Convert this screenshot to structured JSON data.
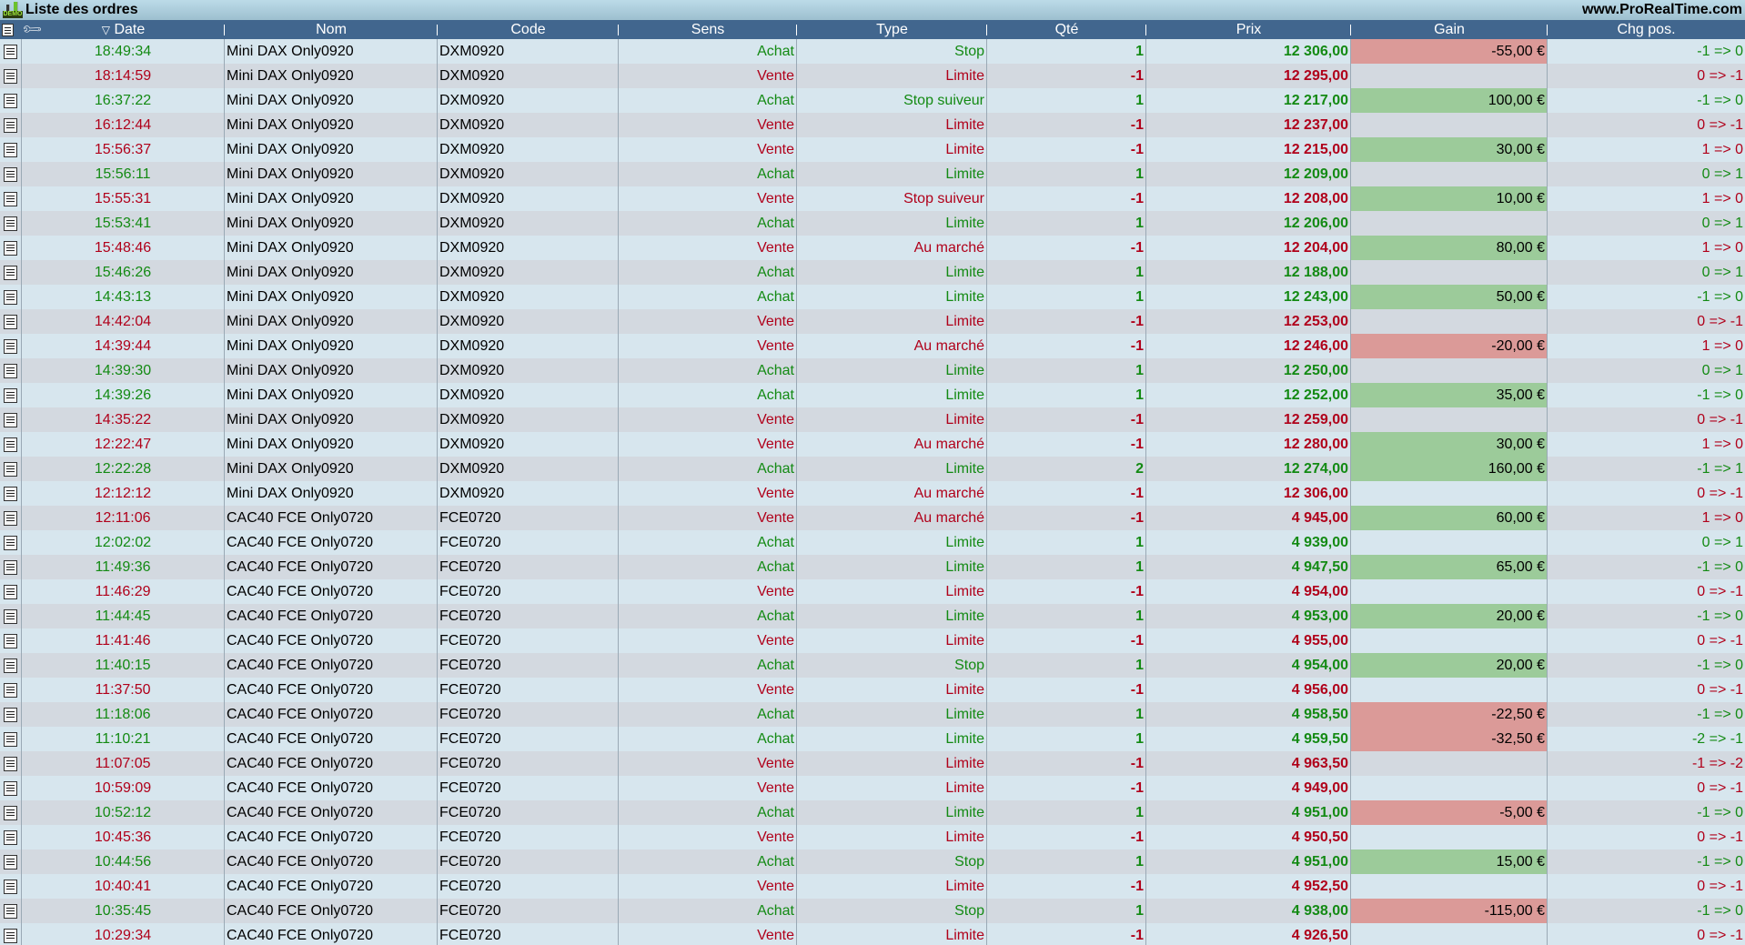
{
  "window": {
    "title": "Liste des ordres",
    "site": "www.ProRealTime.com",
    "badge": "DEMO"
  },
  "columns": {
    "date": "Date",
    "nom": "Nom",
    "code": "Code",
    "sens": "Sens",
    "type": "Type",
    "qte": "Qté",
    "prix": "Prix",
    "gain": "Gain",
    "chg": "Chg pos."
  },
  "sort_indicator": "▽",
  "colors": {
    "green": "#138a13",
    "red": "#b0001a",
    "gain_positive": "#9ccb9a",
    "gain_negative": "#db9a98",
    "header": "#41668e"
  },
  "rows": [
    {
      "date": "18:49:34",
      "nom": "Mini DAX Only0920",
      "code": "DXM0920",
      "sens": "Achat",
      "type": "Stop",
      "qte": "1",
      "prix": "12 306,00",
      "gain": "-55,00 €",
      "chg": "-1 => 0"
    },
    {
      "date": "18:14:59",
      "nom": "Mini DAX Only0920",
      "code": "DXM0920",
      "sens": "Vente",
      "type": "Limite",
      "qte": "-1",
      "prix": "12 295,00",
      "gain": "",
      "chg": "0 => -1"
    },
    {
      "date": "16:37:22",
      "nom": "Mini DAX Only0920",
      "code": "DXM0920",
      "sens": "Achat",
      "type": "Stop suiveur",
      "qte": "1",
      "prix": "12 217,00",
      "gain": "100,00 €",
      "chg": "-1 => 0"
    },
    {
      "date": "16:12:44",
      "nom": "Mini DAX Only0920",
      "code": "DXM0920",
      "sens": "Vente",
      "type": "Limite",
      "qte": "-1",
      "prix": "12 237,00",
      "gain": "",
      "chg": "0 => -1"
    },
    {
      "date": "15:56:37",
      "nom": "Mini DAX Only0920",
      "code": "DXM0920",
      "sens": "Vente",
      "type": "Limite",
      "qte": "-1",
      "prix": "12 215,00",
      "gain": "30,00 €",
      "chg": "1 => 0"
    },
    {
      "date": "15:56:11",
      "nom": "Mini DAX Only0920",
      "code": "DXM0920",
      "sens": "Achat",
      "type": "Limite",
      "qte": "1",
      "prix": "12 209,00",
      "gain": "",
      "chg": "0 => 1"
    },
    {
      "date": "15:55:31",
      "nom": "Mini DAX Only0920",
      "code": "DXM0920",
      "sens": "Vente",
      "type": "Stop suiveur",
      "qte": "-1",
      "prix": "12 208,00",
      "gain": "10,00 €",
      "chg": "1 => 0"
    },
    {
      "date": "15:53:41",
      "nom": "Mini DAX Only0920",
      "code": "DXM0920",
      "sens": "Achat",
      "type": "Limite",
      "qte": "1",
      "prix": "12 206,00",
      "gain": "",
      "chg": "0 => 1"
    },
    {
      "date": "15:48:46",
      "nom": "Mini DAX Only0920",
      "code": "DXM0920",
      "sens": "Vente",
      "type": "Au marché",
      "qte": "-1",
      "prix": "12 204,00",
      "gain": "80,00 €",
      "chg": "1 => 0"
    },
    {
      "date": "15:46:26",
      "nom": "Mini DAX Only0920",
      "code": "DXM0920",
      "sens": "Achat",
      "type": "Limite",
      "qte": "1",
      "prix": "12 188,00",
      "gain": "",
      "chg": "0 => 1"
    },
    {
      "date": "14:43:13",
      "nom": "Mini DAX Only0920",
      "code": "DXM0920",
      "sens": "Achat",
      "type": "Limite",
      "qte": "1",
      "prix": "12 243,00",
      "gain": "50,00 €",
      "chg": "-1 => 0"
    },
    {
      "date": "14:42:04",
      "nom": "Mini DAX Only0920",
      "code": "DXM0920",
      "sens": "Vente",
      "type": "Limite",
      "qte": "-1",
      "prix": "12 253,00",
      "gain": "",
      "chg": "0 => -1"
    },
    {
      "date": "14:39:44",
      "nom": "Mini DAX Only0920",
      "code": "DXM0920",
      "sens": "Vente",
      "type": "Au marché",
      "qte": "-1",
      "prix": "12 246,00",
      "gain": "-20,00 €",
      "chg": "1 => 0"
    },
    {
      "date": "14:39:30",
      "nom": "Mini DAX Only0920",
      "code": "DXM0920",
      "sens": "Achat",
      "type": "Limite",
      "qte": "1",
      "prix": "12 250,00",
      "gain": "",
      "chg": "0 => 1"
    },
    {
      "date": "14:39:26",
      "nom": "Mini DAX Only0920",
      "code": "DXM0920",
      "sens": "Achat",
      "type": "Limite",
      "qte": "1",
      "prix": "12 252,00",
      "gain": "35,00 €",
      "chg": "-1 => 0"
    },
    {
      "date": "14:35:22",
      "nom": "Mini DAX Only0920",
      "code": "DXM0920",
      "sens": "Vente",
      "type": "Limite",
      "qte": "-1",
      "prix": "12 259,00",
      "gain": "",
      "chg": "0 => -1"
    },
    {
      "date": "12:22:47",
      "nom": "Mini DAX Only0920",
      "code": "DXM0920",
      "sens": "Vente",
      "type": "Au marché",
      "qte": "-1",
      "prix": "12 280,00",
      "gain": "30,00 €",
      "chg": "1 => 0"
    },
    {
      "date": "12:22:28",
      "nom": "Mini DAX Only0920",
      "code": "DXM0920",
      "sens": "Achat",
      "type": "Limite",
      "qte": "2",
      "prix": "12 274,00",
      "gain": "160,00 €",
      "chg": "-1 => 1"
    },
    {
      "date": "12:12:12",
      "nom": "Mini DAX Only0920",
      "code": "DXM0920",
      "sens": "Vente",
      "type": "Au marché",
      "qte": "-1",
      "prix": "12 306,00",
      "gain": "",
      "chg": "0 => -1"
    },
    {
      "date": "12:11:06",
      "nom": "CAC40 FCE Only0720",
      "code": "FCE0720",
      "sens": "Vente",
      "type": "Au marché",
      "qte": "-1",
      "prix": "4 945,00",
      "gain": "60,00 €",
      "chg": "1 => 0"
    },
    {
      "date": "12:02:02",
      "nom": "CAC40 FCE Only0720",
      "code": "FCE0720",
      "sens": "Achat",
      "type": "Limite",
      "qte": "1",
      "prix": "4 939,00",
      "gain": "",
      "chg": "0 => 1"
    },
    {
      "date": "11:49:36",
      "nom": "CAC40 FCE Only0720",
      "code": "FCE0720",
      "sens": "Achat",
      "type": "Limite",
      "qte": "1",
      "prix": "4 947,50",
      "gain": "65,00 €",
      "chg": "-1 => 0"
    },
    {
      "date": "11:46:29",
      "nom": "CAC40 FCE Only0720",
      "code": "FCE0720",
      "sens": "Vente",
      "type": "Limite",
      "qte": "-1",
      "prix": "4 954,00",
      "gain": "",
      "chg": "0 => -1"
    },
    {
      "date": "11:44:45",
      "nom": "CAC40 FCE Only0720",
      "code": "FCE0720",
      "sens": "Achat",
      "type": "Limite",
      "qte": "1",
      "prix": "4 953,00",
      "gain": "20,00 €",
      "chg": "-1 => 0"
    },
    {
      "date": "11:41:46",
      "nom": "CAC40 FCE Only0720",
      "code": "FCE0720",
      "sens": "Vente",
      "type": "Limite",
      "qte": "-1",
      "prix": "4 955,00",
      "gain": "",
      "chg": "0 => -1"
    },
    {
      "date": "11:40:15",
      "nom": "CAC40 FCE Only0720",
      "code": "FCE0720",
      "sens": "Achat",
      "type": "Stop",
      "qte": "1",
      "prix": "4 954,00",
      "gain": "20,00 €",
      "chg": "-1 => 0"
    },
    {
      "date": "11:37:50",
      "nom": "CAC40 FCE Only0720",
      "code": "FCE0720",
      "sens": "Vente",
      "type": "Limite",
      "qte": "-1",
      "prix": "4 956,00",
      "gain": "",
      "chg": "0 => -1"
    },
    {
      "date": "11:18:06",
      "nom": "CAC40 FCE Only0720",
      "code": "FCE0720",
      "sens": "Achat",
      "type": "Limite",
      "qte": "1",
      "prix": "4 958,50",
      "gain": "-22,50 €",
      "chg": "-1 => 0"
    },
    {
      "date": "11:10:21",
      "nom": "CAC40 FCE Only0720",
      "code": "FCE0720",
      "sens": "Achat",
      "type": "Limite",
      "qte": "1",
      "prix": "4 959,50",
      "gain": "-32,50 €",
      "chg": "-2 => -1"
    },
    {
      "date": "11:07:05",
      "nom": "CAC40 FCE Only0720",
      "code": "FCE0720",
      "sens": "Vente",
      "type": "Limite",
      "qte": "-1",
      "prix": "4 963,50",
      "gain": "",
      "chg": "-1 => -2"
    },
    {
      "date": "10:59:09",
      "nom": "CAC40 FCE Only0720",
      "code": "FCE0720",
      "sens": "Vente",
      "type": "Limite",
      "qte": "-1",
      "prix": "4 949,00",
      "gain": "",
      "chg": "0 => -1"
    },
    {
      "date": "10:52:12",
      "nom": "CAC40 FCE Only0720",
      "code": "FCE0720",
      "sens": "Achat",
      "type": "Limite",
      "qte": "1",
      "prix": "4 951,00",
      "gain": "-5,00 €",
      "chg": "-1 => 0"
    },
    {
      "date": "10:45:36",
      "nom": "CAC40 FCE Only0720",
      "code": "FCE0720",
      "sens": "Vente",
      "type": "Limite",
      "qte": "-1",
      "prix": "4 950,50",
      "gain": "",
      "chg": "0 => -1"
    },
    {
      "date": "10:44:56",
      "nom": "CAC40 FCE Only0720",
      "code": "FCE0720",
      "sens": "Achat",
      "type": "Stop",
      "qte": "1",
      "prix": "4 951,00",
      "gain": "15,00 €",
      "chg": "-1 => 0"
    },
    {
      "date": "10:40:41",
      "nom": "CAC40 FCE Only0720",
      "code": "FCE0720",
      "sens": "Vente",
      "type": "Limite",
      "qte": "-1",
      "prix": "4 952,50",
      "gain": "",
      "chg": "0 => -1"
    },
    {
      "date": "10:35:45",
      "nom": "CAC40 FCE Only0720",
      "code": "FCE0720",
      "sens": "Achat",
      "type": "Stop",
      "qte": "1",
      "prix": "4 938,00",
      "gain": "-115,00 €",
      "chg": "-1 => 0"
    },
    {
      "date": "10:29:34",
      "nom": "CAC40 FCE Only0720",
      "code": "FCE0720",
      "sens": "Vente",
      "type": "Limite",
      "qte": "-1",
      "prix": "4 926,50",
      "gain": "",
      "chg": "0 => -1"
    }
  ]
}
